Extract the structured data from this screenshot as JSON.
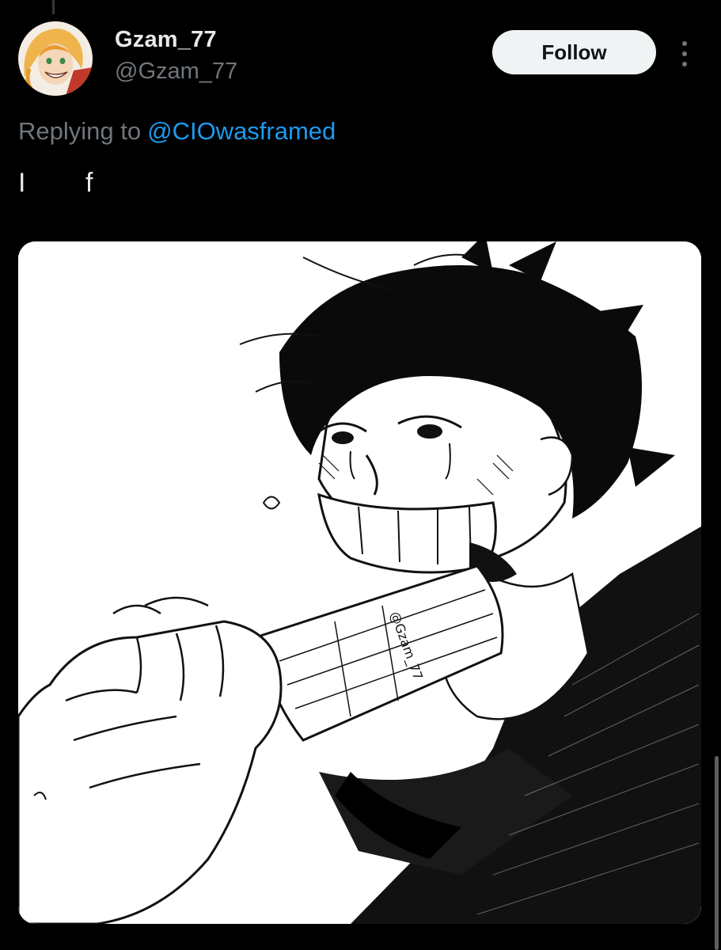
{
  "tweet": {
    "author": {
      "display_name": "Gzam_77",
      "handle": "@Gzam_77",
      "avatar": "avatar-illustration"
    },
    "follow_label": "Follow",
    "more_icon": "more-dots-icon",
    "replying_to": {
      "prefix": "Replying to",
      "mention": "@CIOwasframed"
    },
    "text": "I        f",
    "media": {
      "type": "ink-drawing",
      "watermark": "@Gzam_77"
    }
  },
  "colors": {
    "background": "#000000",
    "text_primary": "#e7e9ea",
    "text_secondary": "#71767b",
    "link": "#1d9bf0",
    "follow_bg": "#eff3f4",
    "follow_text": "#0f1419"
  }
}
